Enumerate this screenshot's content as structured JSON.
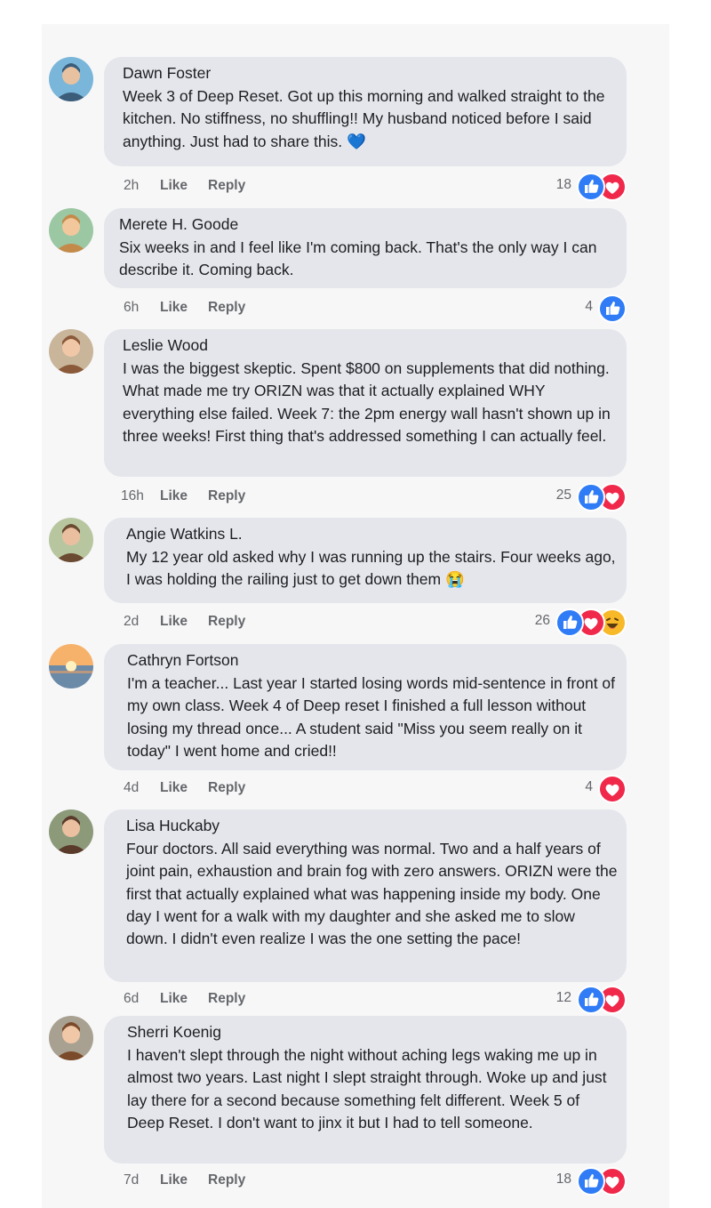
{
  "colors": {
    "panel_bg": "#f7f7f8",
    "bubble_bg": "#e4e6eb",
    "meta_text": "#65676b",
    "like_blue": "#1877f2",
    "love_red": "#f33e58",
    "haha_yellow": "#f7b928"
  },
  "comments": [
    {
      "author": "Dawn Foster",
      "text": "Week 3 of Deep Reset. Got up this morning and walked straight to the kitchen. No stiffness, no shuffling!! My husband noticed before I said anything. Just had to share this. 💙",
      "time": "2h",
      "like_label": "Like",
      "reply_label": "Reply",
      "reaction_count": "18",
      "reactions": [
        "like-icon",
        "love-icon"
      ]
    },
    {
      "author": "Merete H. Goode",
      "text": "Six weeks in and I feel like I'm coming back. That's the only way I can describe it. Coming back.",
      "time": "6h",
      "like_label": "Like",
      "reply_label": "Reply",
      "reaction_count": "4",
      "reactions": [
        "like-icon"
      ]
    },
    {
      "author": "Leslie Wood",
      "text": "I was the biggest skeptic. Spent $800 on supplements that did nothing. What made me try ORIZN was that it actually explained WHY everything else failed. Week 7: the 2pm energy wall hasn't shown up in three weeks! First thing that's addressed something I can actually feel.",
      "time": "16h",
      "like_label": "Like",
      "reply_label": "Reply",
      "reaction_count": "25",
      "reactions": [
        "like-icon",
        "love-icon"
      ]
    },
    {
      "author": "Angie Watkins L.",
      "text": "My 12 year old asked why I was running up the stairs. Four weeks ago, I was holding the railing just to get down them 😭",
      "time": "2d",
      "like_label": "Like",
      "reply_label": "Reply",
      "reaction_count": "26",
      "reactions": [
        "like-icon",
        "love-icon",
        "haha-icon"
      ]
    },
    {
      "author": "Cathryn Fortson",
      "text": "I'm a teacher... Last year I started losing words mid-sentence in front of my own class. Week 4 of Deep reset I finished a full lesson without losing my thread once... A student said \"Miss you seem really on it today\" I went home and cried!!",
      "time": "4d",
      "like_label": "Like",
      "reply_label": "Reply",
      "reaction_count": "4",
      "reactions": [
        "love-icon"
      ]
    },
    {
      "author": "Lisa Huckaby",
      "text": "Four doctors. All said everything was normal. Two and a half years of joint pain, exhaustion and brain fog with zero answers. ORIZN were the first that actually explained what was happening inside my body. One day I went for a walk with my daughter and she asked me to slow down. I didn't even realize I was the one setting the pace!",
      "time": "6d",
      "like_label": "Like",
      "reply_label": "Reply",
      "reaction_count": "12",
      "reactions": [
        "like-icon",
        "love-icon"
      ]
    },
    {
      "author": "Sherri Koenig",
      "text": "I haven't slept through the night without aching legs waking me up in almost two years. Last night I slept straight through. Woke up and just lay there for a second because something felt different. Week 5 of Deep Reset. I don't want to jinx it but I had to tell someone.",
      "time": "7d",
      "like_label": "Like",
      "reply_label": "Reply",
      "reaction_count": "18",
      "reactions": [
        "like-icon",
        "love-icon"
      ]
    }
  ]
}
